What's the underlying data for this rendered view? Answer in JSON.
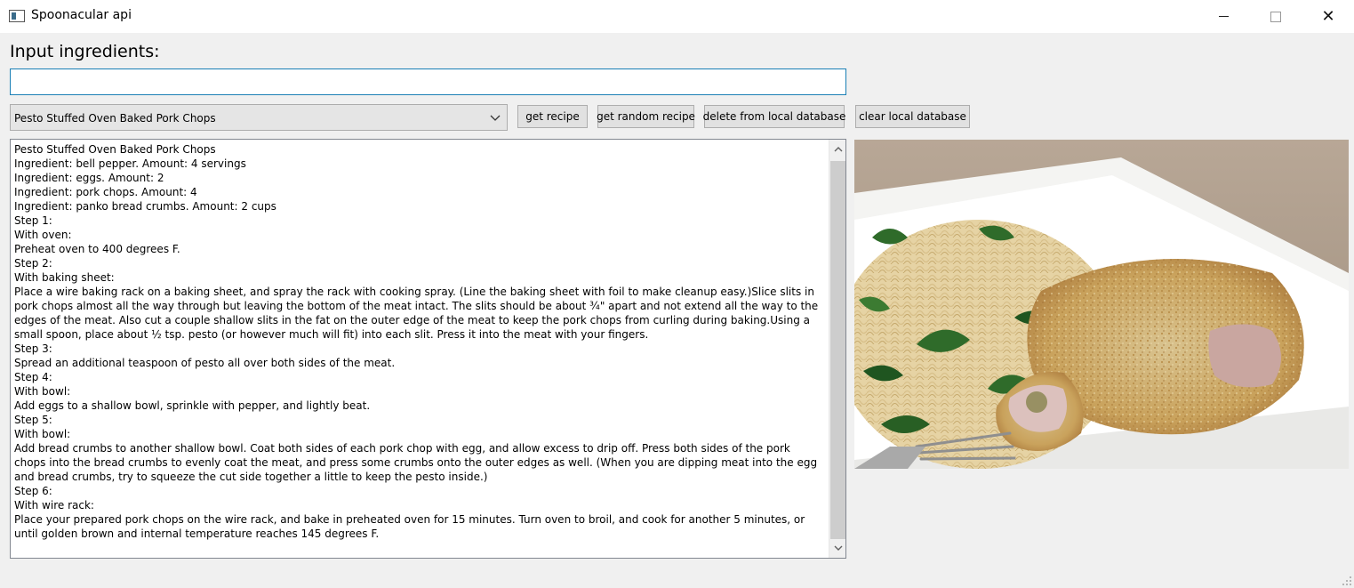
{
  "window": {
    "title": "Spoonacular api",
    "icon": "app-window-icon",
    "controls": [
      "minimize-icon",
      "maximize-icon",
      "close-icon"
    ]
  },
  "input": {
    "label": "Input ingredients:",
    "value": "",
    "placeholder": ""
  },
  "recipe_select": {
    "selected": "Pesto Stuffed Oven Baked Pork Chops"
  },
  "buttons": {
    "get_recipe": "get recipe",
    "get_random_recipe": "get random recipe",
    "delete_from_db": "delete from local database",
    "clear_db": "clear local database"
  },
  "recipe_text": {
    "lines": [
      "Pesto Stuffed Oven Baked Pork Chops",
      "Ingredient: bell pepper. Amount: 4 servings",
      "Ingredient: eggs. Amount: 2",
      "Ingredient: pork chops. Amount: 4",
      "Ingredient: panko bread crumbs. Amount: 2 cups",
      "Step 1:",
      "With oven:",
      "Preheat oven to 400 degrees F.",
      "Step 2:",
      "With baking sheet:",
      "Place a wire baking rack on a baking sheet, and spray the rack with cooking spray. (Line the baking sheet with foil to make cleanup easy.)Slice slits in pork chops almost all the way through but leaving the bottom of the meat intact. The slits should be about ¾\" apart and not extend all the way to the edges of the meat. Also cut a couple shallow slits in the fat on the outer edge of the meat to keep the pork chops from curling during baking.Using a small spoon, place about ½ tsp. pesto (or however much will fit) into each slit. Press it into the meat with your fingers.",
      "Step 3:",
      "Spread an additional teaspoon of pesto all over both sides of the meat.",
      "Step 4:",
      "With bowl:",
      "Add eggs to a shallow bowl, sprinkle with pepper, and lightly beat.",
      "Step 5:",
      "With bowl:",
      "Add bread crumbs to another shallow bowl. Coat both sides of each pork chop with egg, and allow excess to drip off. Press both sides of the pork chops into the bread crumbs to evenly coat the meat, and press some crumbs onto the outer edges as well. (When you are dipping meat into the egg and bread crumbs, try to squeeze the cut side together a little to keep the pesto inside.)",
      "Step 6:",
      "With wire rack:",
      "Place your prepared pork chops on the wire rack, and bake in preheated oven for 15 minutes. Turn oven to broil, and cook for another 5 minutes, or until golden brown and internal temperature reaches 145 degrees F."
    ]
  },
  "image": {
    "subject": "pork-chops-with-spaghetti-photo"
  },
  "colors": {
    "window_bg": "#f0f0f0",
    "input_border": "#1a7fb5",
    "button_bg": "#e1e1e1"
  }
}
